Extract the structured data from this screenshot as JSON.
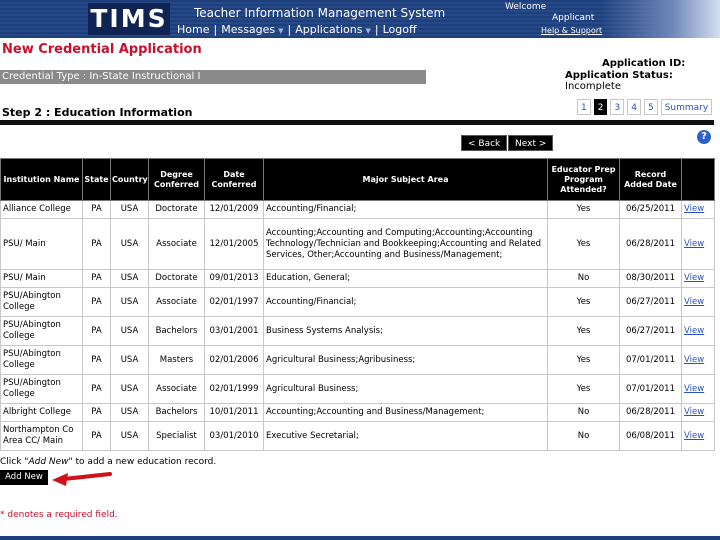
{
  "header": {
    "logo": "TIMS",
    "system_title": "Teacher Information Management System",
    "nav": [
      "Home",
      "Messages",
      "Applications",
      "Logoff"
    ],
    "welcome": "Welcome",
    "applicant": "Applicant",
    "help": "Help & Support"
  },
  "page": {
    "title": "New Credential Application",
    "credential_type": "Credential Type : In-State Instructional I",
    "application_id_label": "Application ID:",
    "application_status_label": "Application Status:",
    "application_status_value": "Incomplete"
  },
  "step": {
    "title": "Step 2 : Education Information",
    "pages": [
      "1",
      "2",
      "3",
      "4",
      "5",
      "Summary"
    ],
    "active_page": "2"
  },
  "buttons": {
    "back": "< Back",
    "next": "Next >",
    "help_icon": "?",
    "add_new": "Add New"
  },
  "table": {
    "headers": [
      "Institution Name",
      "State",
      "Country",
      "Degree Conferred",
      "Date Conferred",
      "Major Subject Area",
      "Educator Prep Program Attended?",
      "Record Added Date",
      ""
    ],
    "rows": [
      [
        "Alliance College",
        "PA",
        "USA",
        "Doctorate",
        "12/01/2009",
        "Accounting/Financial;",
        "Yes",
        "06/25/2011",
        "View"
      ],
      [
        "PSU/ Main",
        "PA",
        "USA",
        "Associate",
        "12/01/2005",
        "Accounting;Accounting and Computing;Accounting;Accounting Technology/Technician and Bookkeeping;Accounting and Related Services, Other;Accounting and Business/Management;",
        "Yes",
        "06/28/2011",
        "View"
      ],
      [
        "PSU/ Main",
        "PA",
        "USA",
        "Doctorate",
        "09/01/2013",
        "Education, General;",
        "No",
        "08/30/2011",
        "View"
      ],
      [
        "PSU/Abington College",
        "PA",
        "USA",
        "Associate",
        "02/01/1997",
        "Accounting/Financial;",
        "Yes",
        "06/27/2011",
        "View"
      ],
      [
        "PSU/Abington College",
        "PA",
        "USA",
        "Bachelors",
        "03/01/2001",
        "Business Systems Analysis;",
        "Yes",
        "06/27/2011",
        "View"
      ],
      [
        "PSU/Abington College",
        "PA",
        "USA",
        "Masters",
        "02/01/2006",
        "Agricultural Business;Agribusiness;",
        "Yes",
        "07/01/2011",
        "View"
      ],
      [
        "PSU/Abington College",
        "PA",
        "USA",
        "Associate",
        "02/01/1999",
        "Agricultural Business;",
        "Yes",
        "07/01/2011",
        "View"
      ],
      [
        "Albright College",
        "PA",
        "USA",
        "Bachelors",
        "10/01/2011",
        "Accounting;Accounting and Business/Management;",
        "No",
        "06/28/2011",
        "View"
      ],
      [
        "Northampton Co Area CC/ Main",
        "PA",
        "USA",
        "Specialist",
        "03/01/2010",
        "Executive Secretarial;",
        "No",
        "06/08/2011",
        "View"
      ]
    ]
  },
  "footer": {
    "hint_prefix": "Click \"",
    "hint_em": "Add New",
    "hint_suffix": "\" to add a new education record.",
    "required_note": "* denotes a required field."
  },
  "colors": {
    "header_bg": "#1f3f7a",
    "title_red": "#c8102e",
    "link_blue": "#2a52be",
    "arrow_red": "#d0101a"
  }
}
